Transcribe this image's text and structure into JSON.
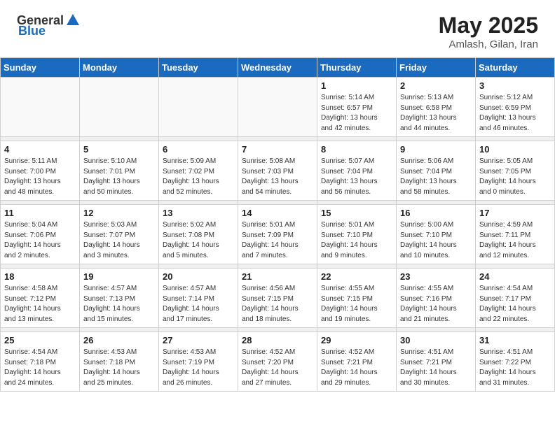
{
  "header": {
    "logo_general": "General",
    "logo_blue": "Blue",
    "month_year": "May 2025",
    "location": "Amlash, Gilan, Iran"
  },
  "weekdays": [
    "Sunday",
    "Monday",
    "Tuesday",
    "Wednesday",
    "Thursday",
    "Friday",
    "Saturday"
  ],
  "weeks": [
    [
      {
        "day": "",
        "info": ""
      },
      {
        "day": "",
        "info": ""
      },
      {
        "day": "",
        "info": ""
      },
      {
        "day": "",
        "info": ""
      },
      {
        "day": "1",
        "info": "Sunrise: 5:14 AM\nSunset: 6:57 PM\nDaylight: 13 hours\nand 42 minutes."
      },
      {
        "day": "2",
        "info": "Sunrise: 5:13 AM\nSunset: 6:58 PM\nDaylight: 13 hours\nand 44 minutes."
      },
      {
        "day": "3",
        "info": "Sunrise: 5:12 AM\nSunset: 6:59 PM\nDaylight: 13 hours\nand 46 minutes."
      }
    ],
    [
      {
        "day": "4",
        "info": "Sunrise: 5:11 AM\nSunset: 7:00 PM\nDaylight: 13 hours\nand 48 minutes."
      },
      {
        "day": "5",
        "info": "Sunrise: 5:10 AM\nSunset: 7:01 PM\nDaylight: 13 hours\nand 50 minutes."
      },
      {
        "day": "6",
        "info": "Sunrise: 5:09 AM\nSunset: 7:02 PM\nDaylight: 13 hours\nand 52 minutes."
      },
      {
        "day": "7",
        "info": "Sunrise: 5:08 AM\nSunset: 7:03 PM\nDaylight: 13 hours\nand 54 minutes."
      },
      {
        "day": "8",
        "info": "Sunrise: 5:07 AM\nSunset: 7:04 PM\nDaylight: 13 hours\nand 56 minutes."
      },
      {
        "day": "9",
        "info": "Sunrise: 5:06 AM\nSunset: 7:04 PM\nDaylight: 13 hours\nand 58 minutes."
      },
      {
        "day": "10",
        "info": "Sunrise: 5:05 AM\nSunset: 7:05 PM\nDaylight: 14 hours\nand 0 minutes."
      }
    ],
    [
      {
        "day": "11",
        "info": "Sunrise: 5:04 AM\nSunset: 7:06 PM\nDaylight: 14 hours\nand 2 minutes."
      },
      {
        "day": "12",
        "info": "Sunrise: 5:03 AM\nSunset: 7:07 PM\nDaylight: 14 hours\nand 3 minutes."
      },
      {
        "day": "13",
        "info": "Sunrise: 5:02 AM\nSunset: 7:08 PM\nDaylight: 14 hours\nand 5 minutes."
      },
      {
        "day": "14",
        "info": "Sunrise: 5:01 AM\nSunset: 7:09 PM\nDaylight: 14 hours\nand 7 minutes."
      },
      {
        "day": "15",
        "info": "Sunrise: 5:01 AM\nSunset: 7:10 PM\nDaylight: 14 hours\nand 9 minutes."
      },
      {
        "day": "16",
        "info": "Sunrise: 5:00 AM\nSunset: 7:10 PM\nDaylight: 14 hours\nand 10 minutes."
      },
      {
        "day": "17",
        "info": "Sunrise: 4:59 AM\nSunset: 7:11 PM\nDaylight: 14 hours\nand 12 minutes."
      }
    ],
    [
      {
        "day": "18",
        "info": "Sunrise: 4:58 AM\nSunset: 7:12 PM\nDaylight: 14 hours\nand 13 minutes."
      },
      {
        "day": "19",
        "info": "Sunrise: 4:57 AM\nSunset: 7:13 PM\nDaylight: 14 hours\nand 15 minutes."
      },
      {
        "day": "20",
        "info": "Sunrise: 4:57 AM\nSunset: 7:14 PM\nDaylight: 14 hours\nand 17 minutes."
      },
      {
        "day": "21",
        "info": "Sunrise: 4:56 AM\nSunset: 7:15 PM\nDaylight: 14 hours\nand 18 minutes."
      },
      {
        "day": "22",
        "info": "Sunrise: 4:55 AM\nSunset: 7:15 PM\nDaylight: 14 hours\nand 19 minutes."
      },
      {
        "day": "23",
        "info": "Sunrise: 4:55 AM\nSunset: 7:16 PM\nDaylight: 14 hours\nand 21 minutes."
      },
      {
        "day": "24",
        "info": "Sunrise: 4:54 AM\nSunset: 7:17 PM\nDaylight: 14 hours\nand 22 minutes."
      }
    ],
    [
      {
        "day": "25",
        "info": "Sunrise: 4:54 AM\nSunset: 7:18 PM\nDaylight: 14 hours\nand 24 minutes."
      },
      {
        "day": "26",
        "info": "Sunrise: 4:53 AM\nSunset: 7:18 PM\nDaylight: 14 hours\nand 25 minutes."
      },
      {
        "day": "27",
        "info": "Sunrise: 4:53 AM\nSunset: 7:19 PM\nDaylight: 14 hours\nand 26 minutes."
      },
      {
        "day": "28",
        "info": "Sunrise: 4:52 AM\nSunset: 7:20 PM\nDaylight: 14 hours\nand 27 minutes."
      },
      {
        "day": "29",
        "info": "Sunrise: 4:52 AM\nSunset: 7:21 PM\nDaylight: 14 hours\nand 29 minutes."
      },
      {
        "day": "30",
        "info": "Sunrise: 4:51 AM\nSunset: 7:21 PM\nDaylight: 14 hours\nand 30 minutes."
      },
      {
        "day": "31",
        "info": "Sunrise: 4:51 AM\nSunset: 7:22 PM\nDaylight: 14 hours\nand 31 minutes."
      }
    ]
  ]
}
